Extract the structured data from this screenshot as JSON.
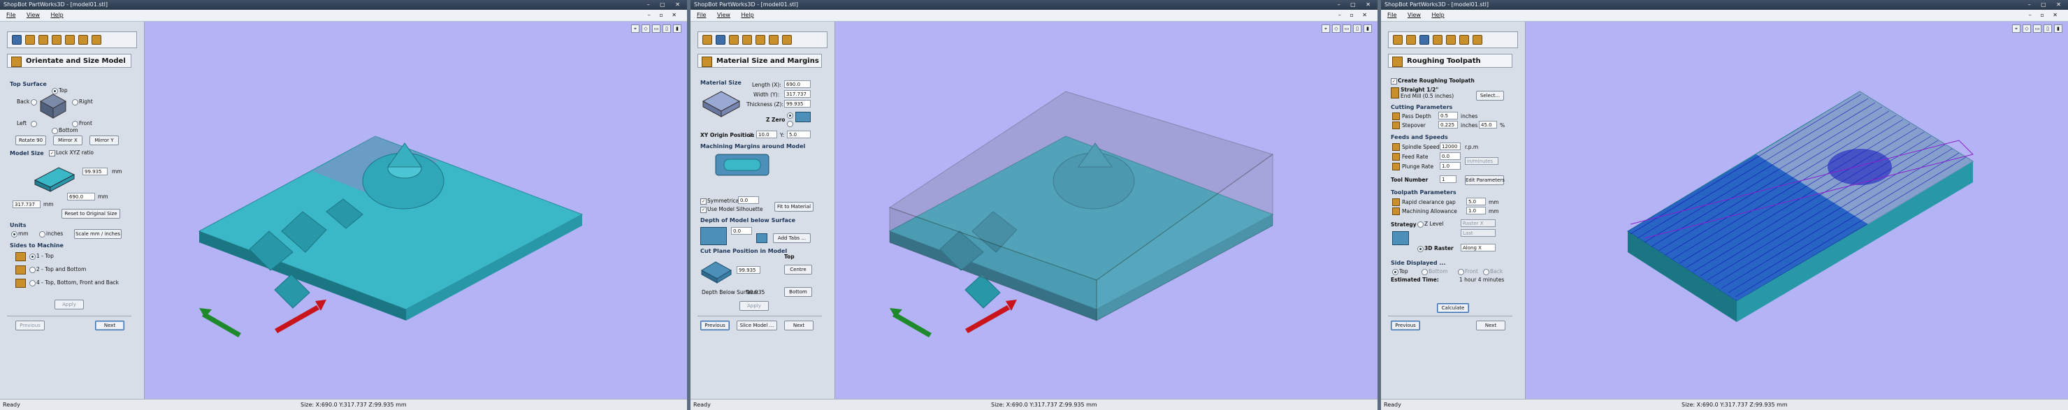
{
  "app": {
    "title": "ShopBot PartWorks3D - [model01.stl]",
    "menus": [
      "File",
      "View",
      "Help"
    ]
  },
  "status": {
    "ready": "Ready",
    "size": "Size: X:690.0 Y:317.737 Z:99.935 mm"
  },
  "viewport": {
    "background": "#b4b3f6",
    "model_color": "#3bb8c8",
    "tool_icons": [
      "zoom-extents-icon",
      "view-iso-icon",
      "view-top-icon",
      "view-front-icon",
      "view-side-icon"
    ]
  },
  "w1": {
    "section_title": "Orientate and Size Model",
    "top_surface": {
      "header": "Top Surface",
      "top": "Top",
      "back": "Back",
      "right": "Right",
      "left": "Left",
      "front": "Front",
      "bottom": "Bottom"
    },
    "buttons": {
      "rotate": "Rotate 90",
      "mirror_x": "Mirror X",
      "mirror_y": "Mirror Y"
    },
    "model_size": {
      "header": "Model Size",
      "lock": "Lock XYZ ratio",
      "z_value": "99.935",
      "z_unit": "mm",
      "x_value": "690.0",
      "x_unit": "mm",
      "y_value": "317.737",
      "y_unit": "mm",
      "reset": "Reset to Original Size"
    },
    "units": {
      "header": "Units",
      "mm": "mm",
      "inches": "inches",
      "scale": "Scale mm / inches"
    },
    "sides": {
      "header": "Sides to Machine",
      "opt1": "1 - Top",
      "opt2": "2 - Top and Bottom",
      "opt3": "4 - Top, Bottom, Front and Back"
    },
    "apply": "Apply",
    "previous": "Previous",
    "next": "Next"
  },
  "w2": {
    "section_title": "Material Size and Margins",
    "material": {
      "header": "Material Size",
      "length_label": "Length (X):",
      "length": "690.0",
      "width_label": "Width (Y):",
      "width": "317.737",
      "thickness_label": "Thickness (Z):",
      "thickness": "99.935",
      "zzero": "Z Zero"
    },
    "origin": {
      "label": "XY Origin Position",
      "x_label": "X:",
      "x": "10.0",
      "y_label": "Y:",
      "y": "5.0"
    },
    "margins": {
      "header": "Machining Margins around Model",
      "symmetrical": "Symmetrical",
      "sym_value": "0.0",
      "silhouette": "Use Model Silhouette",
      "fit": "Fit to Material"
    },
    "depth": {
      "header": "Depth of Model below Surface",
      "value": "0.0",
      "add_tabs": "Add Tabs ..."
    },
    "cut_plane": {
      "header": "Cut Plane Position in Model",
      "value": "99.935",
      "top_header": "Top",
      "centre": "Centre",
      "bottom": "Bottom",
      "depth_label": "Depth Below Surface:",
      "depth_value": "99.935"
    },
    "apply": "Apply",
    "previous": "Previous",
    "slice": "Slice Model ...",
    "next": "Next"
  },
  "w3": {
    "section_title": "Roughing Toolpath",
    "create": "Create Roughing Toolpath",
    "tool_name": "Straight 1/2\"",
    "tool_desc": "End Mill (0.5 inches)",
    "select": "Select...",
    "cutting": {
      "header": "Cutting Parameters",
      "pass_label": "Pass Depth",
      "pass_value": "0.5",
      "pass_unit": "inches",
      "step_label": "Stepover",
      "step_value": "0.225",
      "step_unit": "inches",
      "step_pct": "45.0",
      "pct": "%"
    },
    "feeds": {
      "header": "Feeds and Speeds",
      "spindle_label": "Spindle Speed",
      "spindle_value": "12000",
      "spindle_unit": "r.p.m",
      "feed_label": "Feed Rate",
      "feed_value": "0.0",
      "plunge_label": "Plunge Rate",
      "plunge_value": "1.0",
      "rate_unit": "in/minutes"
    },
    "tool_number": {
      "label": "Tool Number",
      "value": "1",
      "edit": "Edit Parameters"
    },
    "toolpath": {
      "header": "Toolpath Parameters",
      "rapid_label": "Rapid clearance gap",
      "rapid_value": "5.0",
      "rapid_unit": "mm",
      "allow_label": "Machining Allowance",
      "allow_value": "1.0",
      "allow_unit": "mm"
    },
    "strategy": {
      "label": "Strategy",
      "z_level": "Z Level",
      "raster_x": "Raster X",
      "last": "Last",
      "raster3d": "3D Raster",
      "along": "Along X"
    },
    "side": {
      "header": "Side Displayed ...",
      "top": "Top",
      "bottom": "Bottom",
      "front": "Front",
      "back": "Back",
      "est_label": "Estimated Time:",
      "est_value": "1 hour 4 minutes"
    },
    "calculate": "Calculate",
    "previous": "Previous",
    "next": "Next"
  }
}
